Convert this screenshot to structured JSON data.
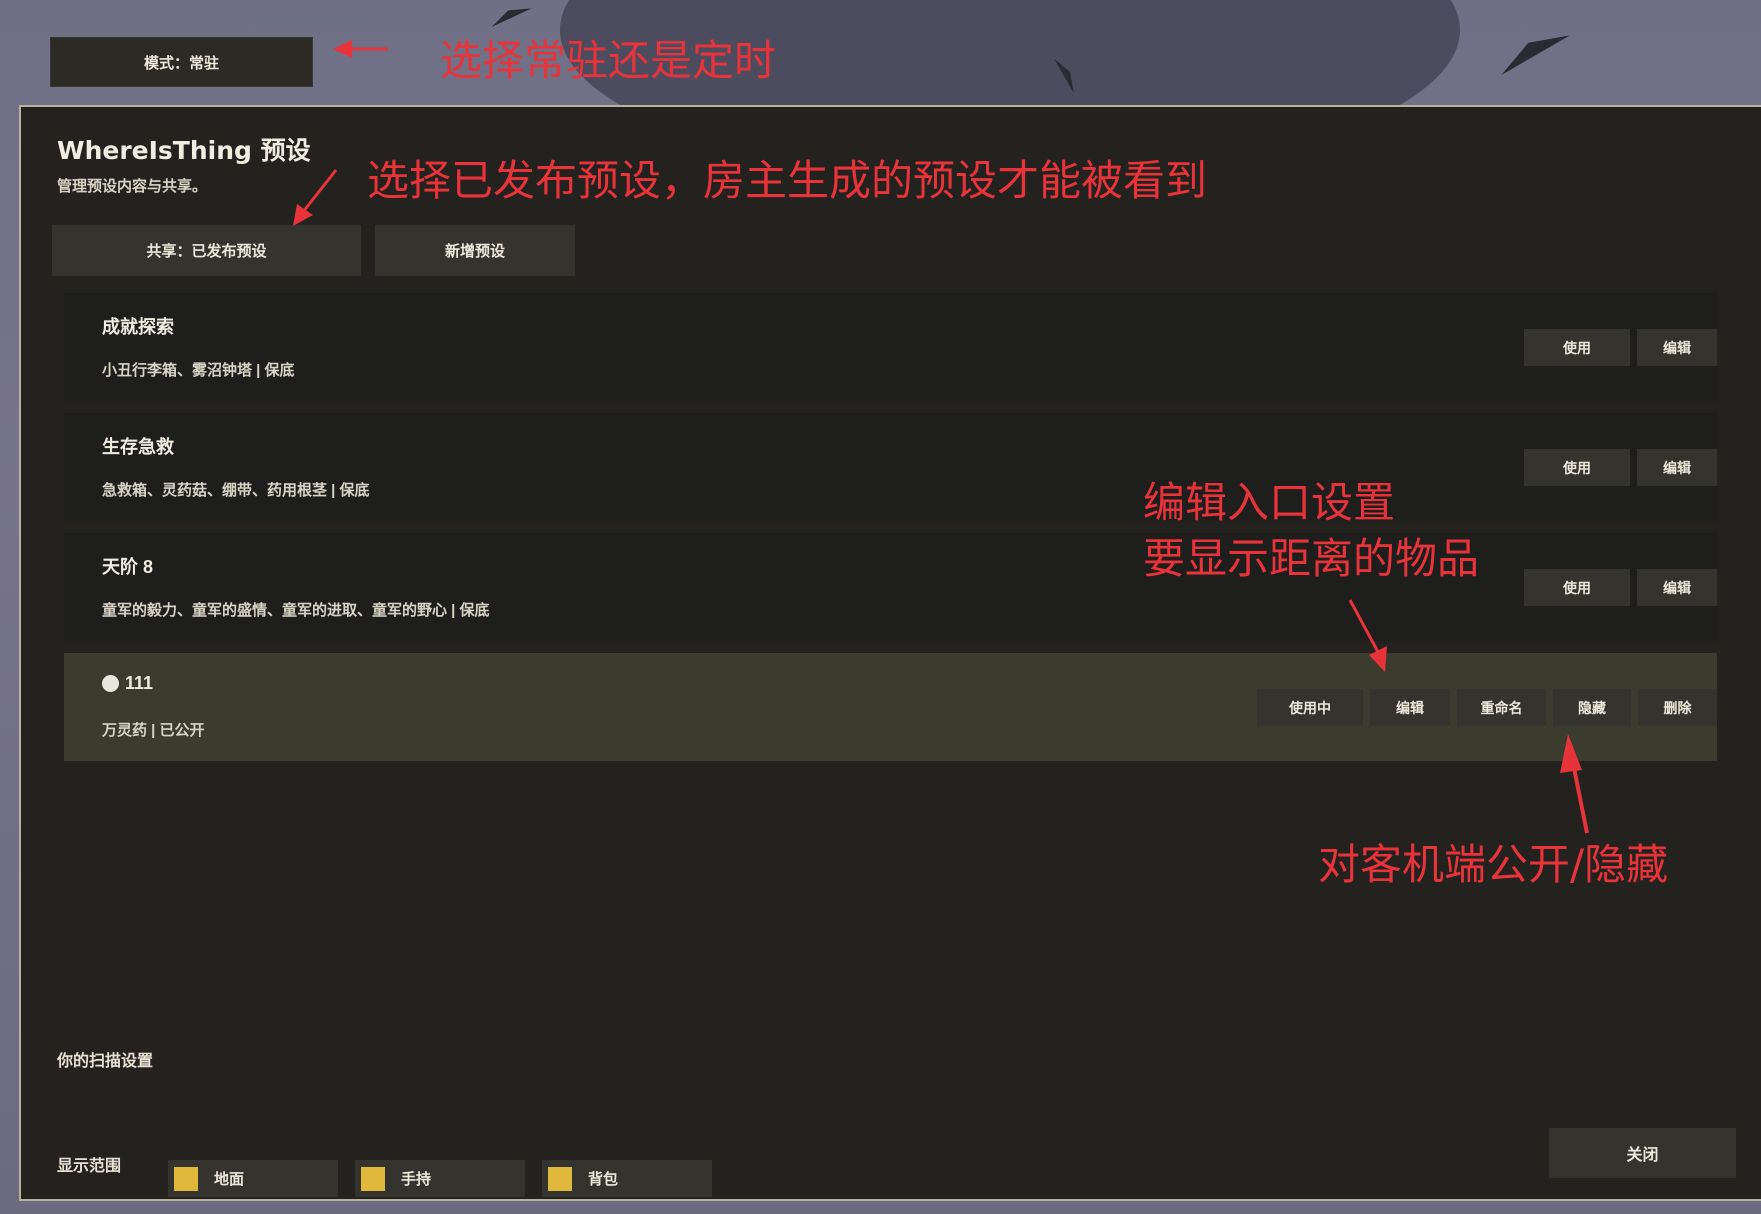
{
  "mode": {
    "label": "模式：常驻"
  },
  "panel": {
    "title": "WhereIsThing 预设",
    "subtitle": "管理预设内容与共享。",
    "share_label": "共享：已发布预设",
    "new_label": "新增预设"
  },
  "presets": [
    {
      "name": "成就探索",
      "desc": "小丑行李箱、雾沼钟塔 | 保底",
      "use": "使用",
      "edit": "编辑"
    },
    {
      "name": "生存急救",
      "desc": "急救箱、灵药菇、绷带、药用根茎 | 保底",
      "use": "使用",
      "edit": "编辑"
    },
    {
      "name": "天阶 8",
      "desc": "童军的毅力、童军的盛情、童军的进取、童军的野心 | 保底",
      "use": "使用",
      "edit": "编辑"
    },
    {
      "name": "111",
      "desc": "万灵药 | 已公开",
      "use": "使用中",
      "edit": "编辑",
      "rename": "重命名",
      "hide": "隐藏",
      "delete": "删除"
    }
  ],
  "scan": {
    "title": "你的扫描设置",
    "range_label": "显示范围",
    "options": [
      "地面",
      "手持",
      "背包"
    ],
    "checkbox_color": "#e0b93c"
  },
  "close_label": "关闭",
  "annotations": {
    "mode": "选择常驻还是定时",
    "share": "选择已发布预设，房主生成的预设才能被看到",
    "edit_line1": "编辑入口设置",
    "edit_line2": "要显示距离的物品",
    "hide": "对客机端公开/隐藏",
    "color": "#e8333a"
  }
}
